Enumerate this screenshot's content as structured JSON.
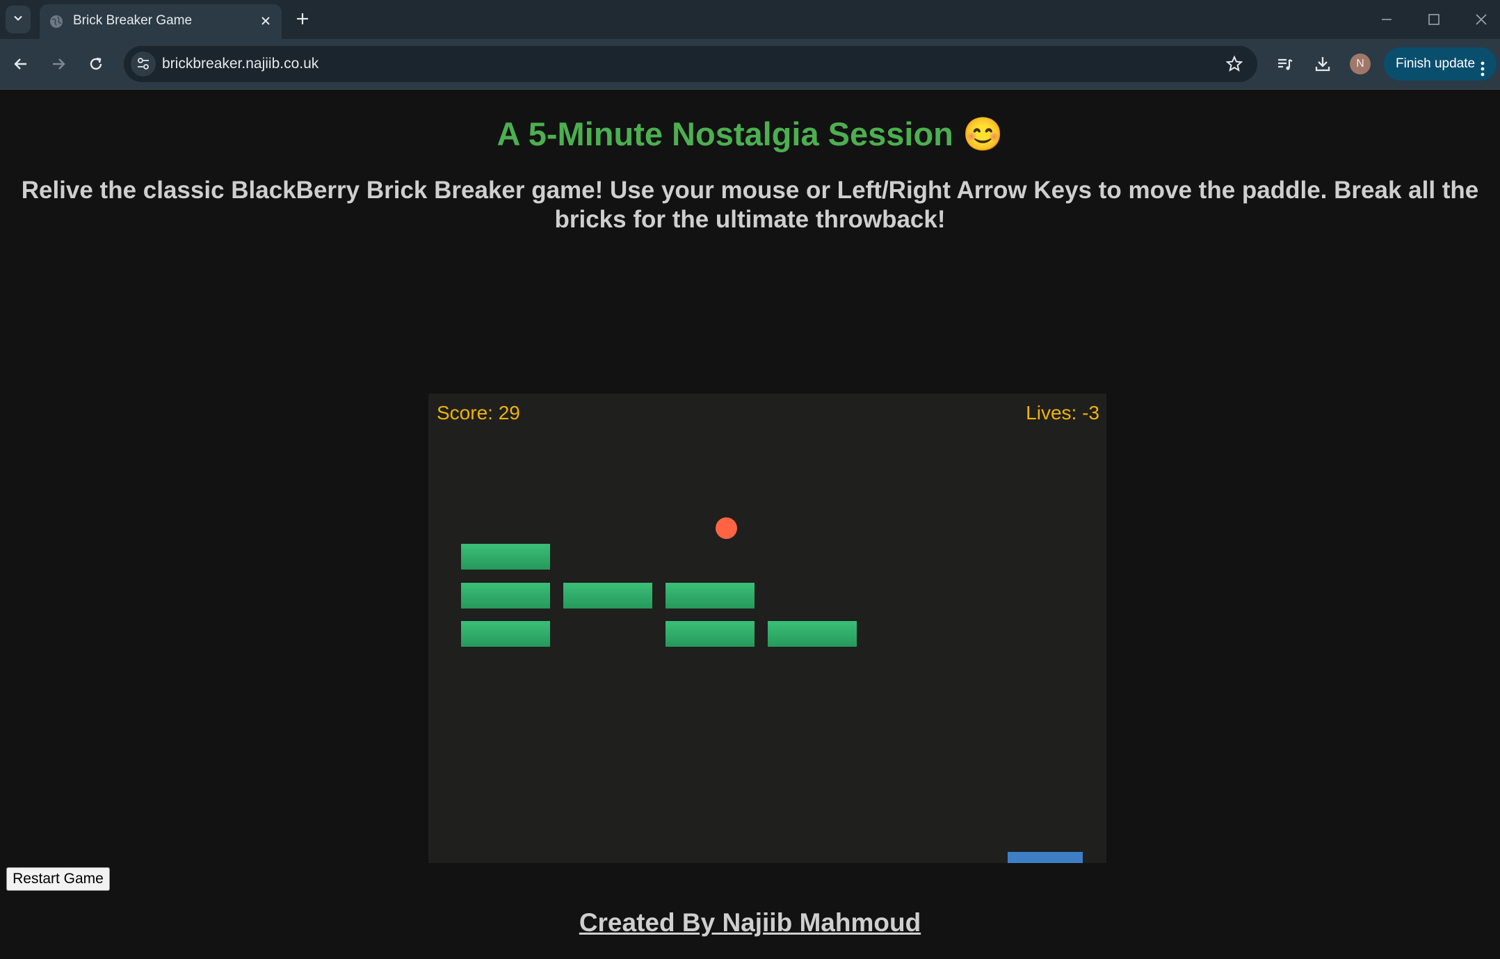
{
  "browser": {
    "tab_title": "Brick Breaker Game",
    "url": "brickbreaker.najiib.co.uk",
    "profile_initial": "N",
    "update_label": "Finish update",
    "icons": [
      "tab-search-icon",
      "globe-icon",
      "close-icon",
      "plus-icon",
      "minimize-icon",
      "maximize-icon",
      "window-close-icon",
      "back-icon",
      "forward-icon",
      "reload-icon",
      "tune-icon",
      "star-icon",
      "media-icon",
      "download-icon",
      "kebab-icon"
    ]
  },
  "page": {
    "headline": "A 5-Minute Nostalgia Session 😊",
    "description": "Relive the classic BlackBerry Brick Breaker game! Use your mouse or Left/Right Arrow Keys to move the paddle. Break all the bricks for the ultimate throwback!",
    "restart_label": "Restart Game",
    "credit": "Created By Najiib Mahmoud"
  },
  "game": {
    "score_text": "Score: 29",
    "lives_text": "Lives: -3",
    "score": 29,
    "lives": -3,
    "colors": {
      "background": "#1f1f1e",
      "brick": "#2eaa66",
      "ball": "#ff6442",
      "paddle": "#3e7fc4",
      "hud": "#f0b400"
    }
  }
}
